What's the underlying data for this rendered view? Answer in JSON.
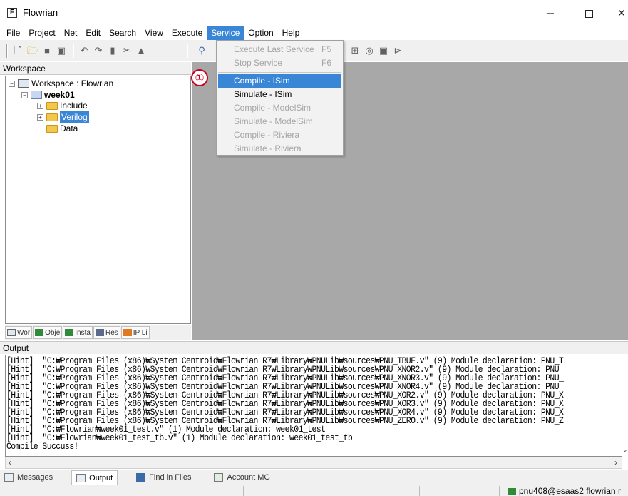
{
  "window": {
    "app_icon_letter": "F",
    "title": "Flowrian",
    "min_glyph": "─",
    "close_glyph": "✕"
  },
  "menu": {
    "items": [
      "File",
      "Project",
      "Net",
      "Edit",
      "Search",
      "View",
      "Execute",
      "Service",
      "Option",
      "Help"
    ],
    "active": "Service"
  },
  "service_menu": {
    "items": [
      {
        "label": "Execute Last Service",
        "shortcut": "F5",
        "enabled": false
      },
      {
        "label": "Stop Service",
        "shortcut": "F6",
        "enabled": false
      },
      {
        "label": "Compile - ISim",
        "shortcut": "",
        "enabled": true,
        "highlighted": true
      },
      {
        "label": "Simulate - ISim",
        "shortcut": "",
        "enabled": true
      },
      {
        "label": "Compile - ModelSim",
        "shortcut": "",
        "enabled": false
      },
      {
        "label": "Simulate - ModelSim",
        "shortcut": "",
        "enabled": false
      },
      {
        "label": "Compile - Riviera",
        "shortcut": "",
        "enabled": false
      },
      {
        "label": "Simulate - Riviera",
        "shortcut": "",
        "enabled": false
      }
    ]
  },
  "callout": "①",
  "workspace": {
    "header": "Workspace",
    "tree": {
      "root": "Workspace : Flowrian",
      "project": "week01",
      "folders": [
        "Include",
        "Verilog",
        "Data"
      ],
      "selected": "Verilog"
    },
    "tabs": [
      "Wor",
      "Obje",
      "Insta",
      "Res",
      "IP Li"
    ]
  },
  "output": {
    "header": "Output",
    "lines": [
      "[Hint]  \"C:₩Program Files (x86)₩System Centroid₩Flowrian R7₩Library₩PNULib₩sources₩PNU_TBUF.v\" (9) Module declaration: PNU_T",
      "[Hint]  \"C:₩Program Files (x86)₩System Centroid₩Flowrian R7₩Library₩PNULib₩sources₩PNU_XNOR2.v\" (9) Module declaration: PNU_",
      "[Hint]  \"C:₩Program Files (x86)₩System Centroid₩Flowrian R7₩Library₩PNULib₩sources₩PNU_XNOR3.v\" (9) Module declaration: PNU_",
      "[Hint]  \"C:₩Program Files (x86)₩System Centroid₩Flowrian R7₩Library₩PNULib₩sources₩PNU_XNOR4.v\" (9) Module declaration: PNU_",
      "[Hint]  \"C:₩Program Files (x86)₩System Centroid₩Flowrian R7₩Library₩PNULib₩sources₩PNU_XOR2.v\" (9) Module declaration: PNU_X",
      "[Hint]  \"C:₩Program Files (x86)₩System Centroid₩Flowrian R7₩Library₩PNULib₩sources₩PNU_XOR3.v\" (9) Module declaration: PNU_X",
      "[Hint]  \"C:₩Program Files (x86)₩System Centroid₩Flowrian R7₩Library₩PNULib₩sources₩PNU_XOR4.v\" (9) Module declaration: PNU_X",
      "[Hint]  \"C:₩Program Files (x86)₩System Centroid₩Flowrian R7₩Library₩PNULib₩sources₩PNU_ZERO.v\" (9) Module declaration: PNU_Z",
      "[Hint]  \"C:₩Flowrian₩week01_test.v\" (1) Module declaration: week01_test",
      "[Hint]  \"C:₩Flowrian₩week01_test_tb.v\" (1) Module declaration: week01_test_tb",
      "Compile Succuss!"
    ],
    "tabs": [
      {
        "label": "Messages",
        "active": false
      },
      {
        "label": "Output",
        "active": true
      },
      {
        "label": "Find in Files",
        "active": false
      },
      {
        "label": "Account MG",
        "active": false
      }
    ]
  },
  "status": {
    "user": "pnu408@esaas2 flowrian r"
  }
}
